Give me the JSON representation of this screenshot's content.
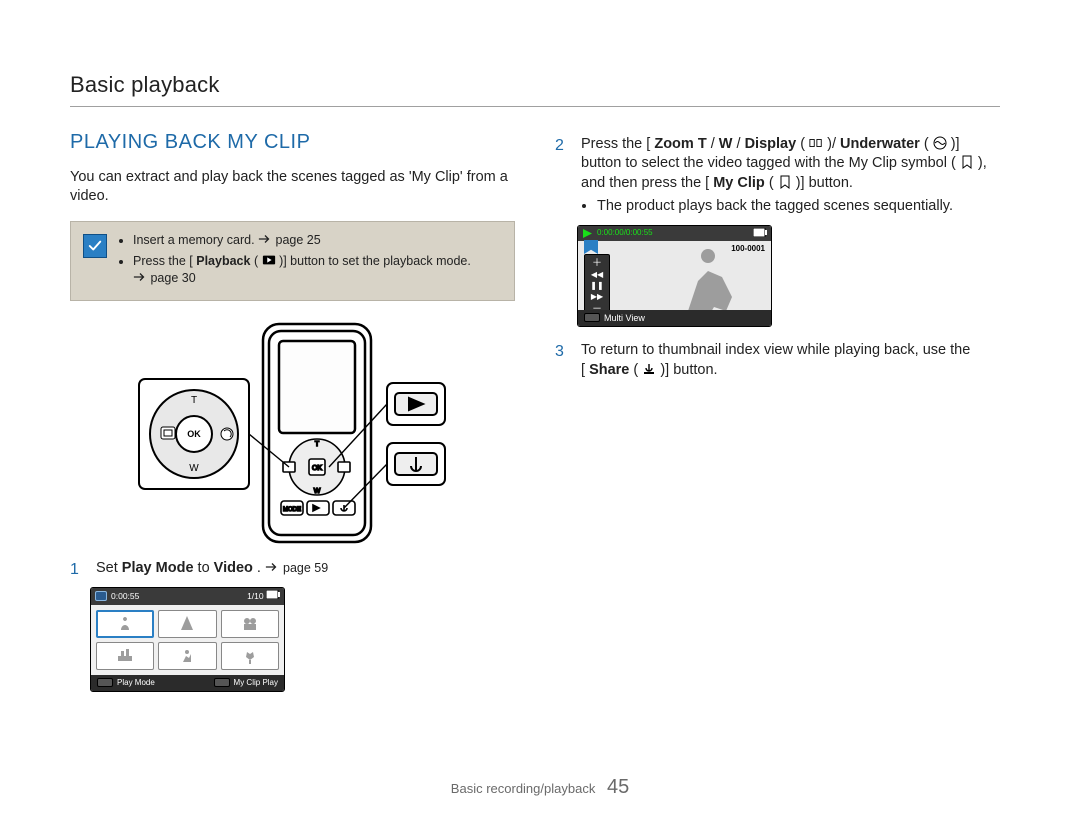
{
  "page": {
    "running_head": "Basic playback",
    "section_title": "PLAYING BACK MY CLIP",
    "intro": "You can extract and play back the scenes tagged as 'My Clip' from a video.",
    "footer_label": "Basic recording/playback",
    "page_number": "45"
  },
  "notes": {
    "items": [
      {
        "pre": "Insert a memory card. ",
        "ref": "page 25"
      },
      {
        "pre": "Press the [",
        "bold1": "Playback",
        "mid": " (",
        "icon": "play-in-box-icon",
        "post": ")] button to set the playback mode. ",
        "ref": "page 30"
      }
    ]
  },
  "steps": {
    "one": {
      "num": "1",
      "pre": "Set ",
      "b1": "Play Mode",
      "mid": " to ",
      "b2": "Video",
      "post": ". ",
      "ref": "page 59"
    },
    "two": {
      "num": "2",
      "l1_pre": "Press the [",
      "l1_b1": "Zoom T",
      "l1_s1": "/",
      "l1_b2": "W",
      "l1_s2": "/",
      "l1_b3": "Display",
      "l1_s3": " (",
      "l1_icon1": "display-icon",
      "l1_s4": ")/",
      "l1_b4": "Underwater",
      "l1_s5": " (",
      "l1_icon2": "underwater-icon",
      "l1_s6": ")] button",
      "l2_pre": "to select the video tagged with the My Clip symbol (",
      "l2_icon": "myclip-tag-icon",
      "l2_post": "), and",
      "l3_pre": "then press the [",
      "l3_b1": "My Clip",
      "l3_mid": " (",
      "l3_icon": "myclip-button-icon",
      "l3_post": ")] button.",
      "bullet": "The product plays back the tagged scenes sequentially."
    },
    "three": {
      "num": "3",
      "pre": "To return to thumbnail index view while playing back, use the",
      "l2_pre": "[",
      "l2_b1": "Share",
      "l2_mid": " (",
      "l2_icon": "share-icon",
      "l2_post": ")] button."
    }
  },
  "screenshot_grid": {
    "time": "0:00:55",
    "counter": "1/10",
    "foot_left": "Play Mode",
    "foot_right": "My Clip Play"
  },
  "screenshot_play": {
    "timecode": "0:00:00/0:00:55",
    "filenum": "100-0001",
    "foot": "Multi View"
  },
  "device": {
    "btn_t": "T",
    "btn_w": "W",
    "btn_ok": "OK"
  }
}
